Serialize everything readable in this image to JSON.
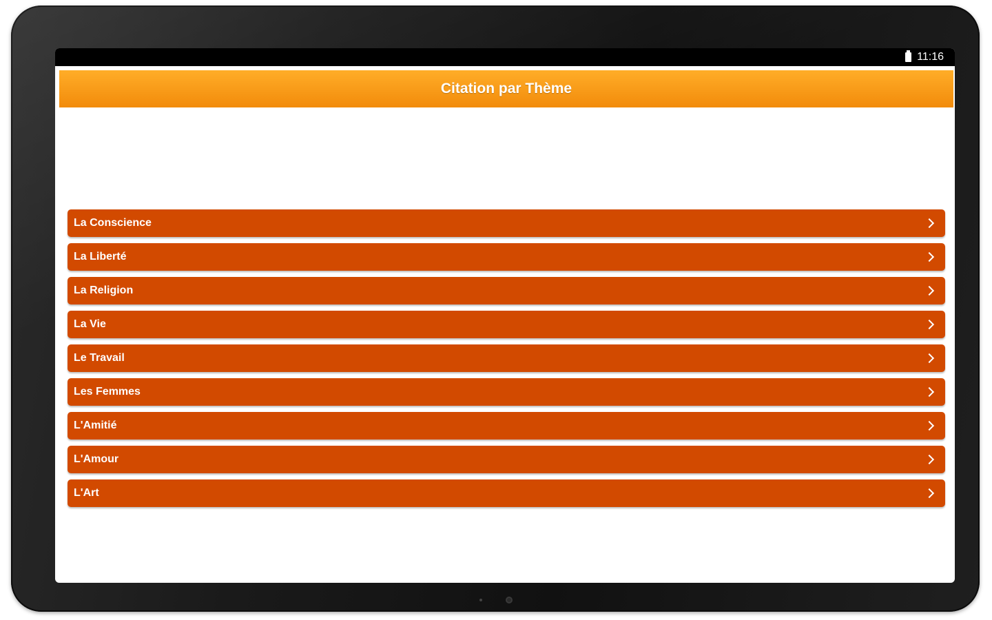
{
  "status_bar": {
    "time": "11:16",
    "battery_icon": "battery-icon"
  },
  "header": {
    "title": "Citation par Thème",
    "color_top": "#ffad28",
    "color_bottom": "#f28b0b"
  },
  "themes": {
    "item_color": "#d24a00",
    "items": [
      {
        "label": "La Conscience"
      },
      {
        "label": "La Liberté"
      },
      {
        "label": "La Religion"
      },
      {
        "label": "La Vie"
      },
      {
        "label": "Le Travail"
      },
      {
        "label": "Les Femmes"
      },
      {
        "label": "L'Amitié"
      },
      {
        "label": "L'Amour"
      },
      {
        "label": "L'Art"
      }
    ]
  }
}
